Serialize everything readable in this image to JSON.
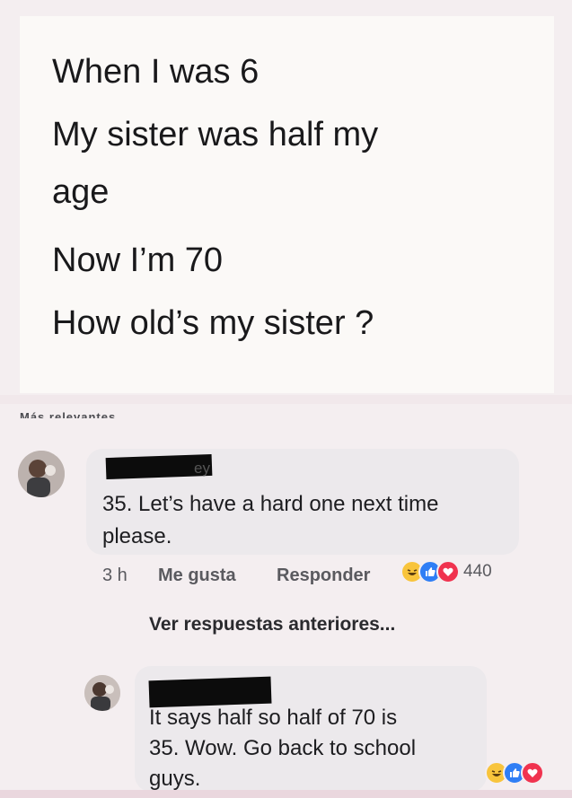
{
  "post": {
    "lines": [
      "When I was 6",
      "My sister was half my",
      "age",
      "Now I’m 70",
      "How old’s my sister ?"
    ]
  },
  "filter_label": "Más relevantes",
  "comments": [
    {
      "author_fragment": "ey",
      "text_lines": [
        "35. Let’s have a hard one next time",
        "please."
      ],
      "time": "3 h",
      "like_label": "Me gusta",
      "reply_label": "Responder",
      "reactions": [
        "haha",
        "like",
        "love"
      ],
      "reaction_count": "440"
    },
    {
      "text_lines": [
        "It says half so half of 70 is",
        "35. Wow. Go back to school",
        "guys."
      ],
      "reactions": [
        "haha",
        "like",
        "love"
      ]
    }
  ],
  "view_previous": "Ver respuestas anteriores...",
  "colors": {
    "haha": "#f8c43c",
    "like": "#2f7ef5",
    "love": "#f0334f",
    "bubble": "#ece9ec"
  }
}
